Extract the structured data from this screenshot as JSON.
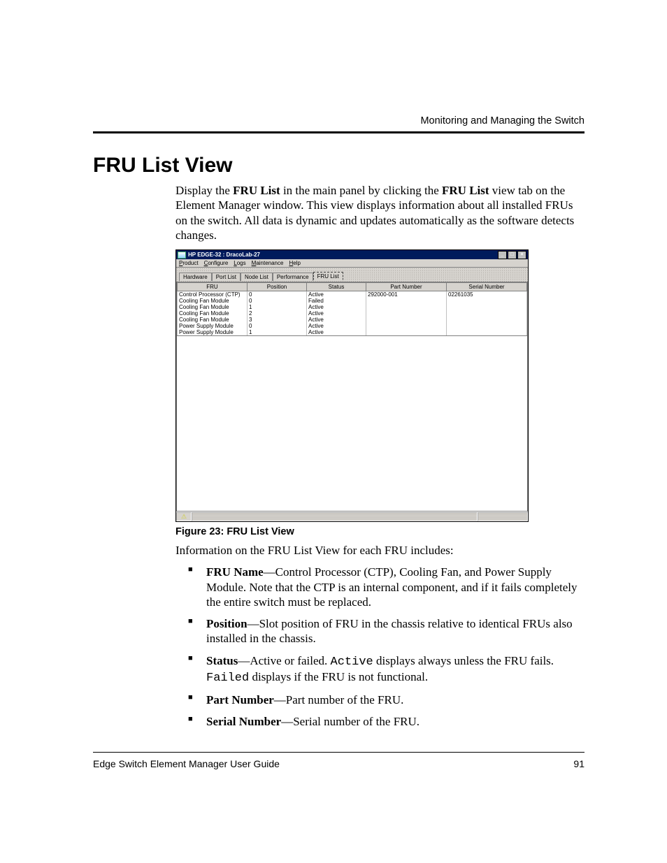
{
  "header": {
    "running_head": "Monitoring and Managing the Switch"
  },
  "section": {
    "title": "FRU List View",
    "intro_pre": "Display the ",
    "intro_b1": "FRU List",
    "intro_mid": " in the main panel by clicking the ",
    "intro_b2": "FRU List",
    "intro_post": " view tab on the Element Manager window. This view displays information about all installed FRUs on the switch. All data is dynamic and updates automatically as the software detects changes."
  },
  "app": {
    "title": "HP EDGE-32 : DracoLab-27",
    "menus": {
      "product": "Product",
      "configure": "Configure",
      "logs": "Logs",
      "maintenance": "Maintenance",
      "help": "Help"
    },
    "tabs": {
      "hardware": "Hardware",
      "portlist": "Port List",
      "nodelist": "Node List",
      "performance": "Performance",
      "frulist": "FRU List"
    },
    "columns": {
      "fru": "FRU",
      "position": "Position",
      "status": "Status",
      "partnumber": "Part Number",
      "serialnumber": "Serial Number"
    },
    "rows": [
      {
        "fru": "Control Processor (CTP)",
        "position": "0",
        "status": "Active",
        "partnumber": "292000-001",
        "serialnumber": "02261035"
      },
      {
        "fru": "Cooling Fan Module",
        "position": "0",
        "status": "Failed",
        "partnumber": "",
        "serialnumber": ""
      },
      {
        "fru": "Cooling Fan Module",
        "position": "1",
        "status": "Active",
        "partnumber": "",
        "serialnumber": ""
      },
      {
        "fru": "Cooling Fan Module",
        "position": "2",
        "status": "Active",
        "partnumber": "",
        "serialnumber": ""
      },
      {
        "fru": "Cooling Fan Module",
        "position": "3",
        "status": "Active",
        "partnumber": "",
        "serialnumber": ""
      },
      {
        "fru": "Power Supply Module",
        "position": "0",
        "status": "Active",
        "partnumber": "",
        "serialnumber": ""
      },
      {
        "fru": "Power Supply Module",
        "position": "1",
        "status": "Active",
        "partnumber": "",
        "serialnumber": ""
      }
    ],
    "winbtns": {
      "min": "_",
      "max": "□",
      "close": "×"
    },
    "status_icon": "⚠"
  },
  "figure": {
    "caption": "Figure 23:  FRU List View"
  },
  "info": {
    "lead": "Information on the FRU List View for each FRU includes:",
    "items": {
      "fru_name_b": "FRU Name",
      "fru_name_t": "—Control Processor (CTP), Cooling Fan, and Power Supply Module. Note that the CTP is an internal component, and if it fails completely the entire switch must be replaced.",
      "position_b": "Position",
      "position_t": "—Slot position of FRU in the chassis relative to identical FRUs also installed in the chassis.",
      "status_b": "Status",
      "status_t1": "—Active or failed. ",
      "status_c1": "Active",
      "status_t2": " displays always unless the FRU fails. ",
      "status_c2": "Failed",
      "status_t3": " displays if the FRU is not functional.",
      "part_b": "Part Number",
      "part_t": "—Part number of the FRU.",
      "serial_b": "Serial Number",
      "serial_t": "—Serial number of the FRU."
    }
  },
  "footer": {
    "left": "Edge Switch Element Manager User Guide",
    "page": "91"
  }
}
